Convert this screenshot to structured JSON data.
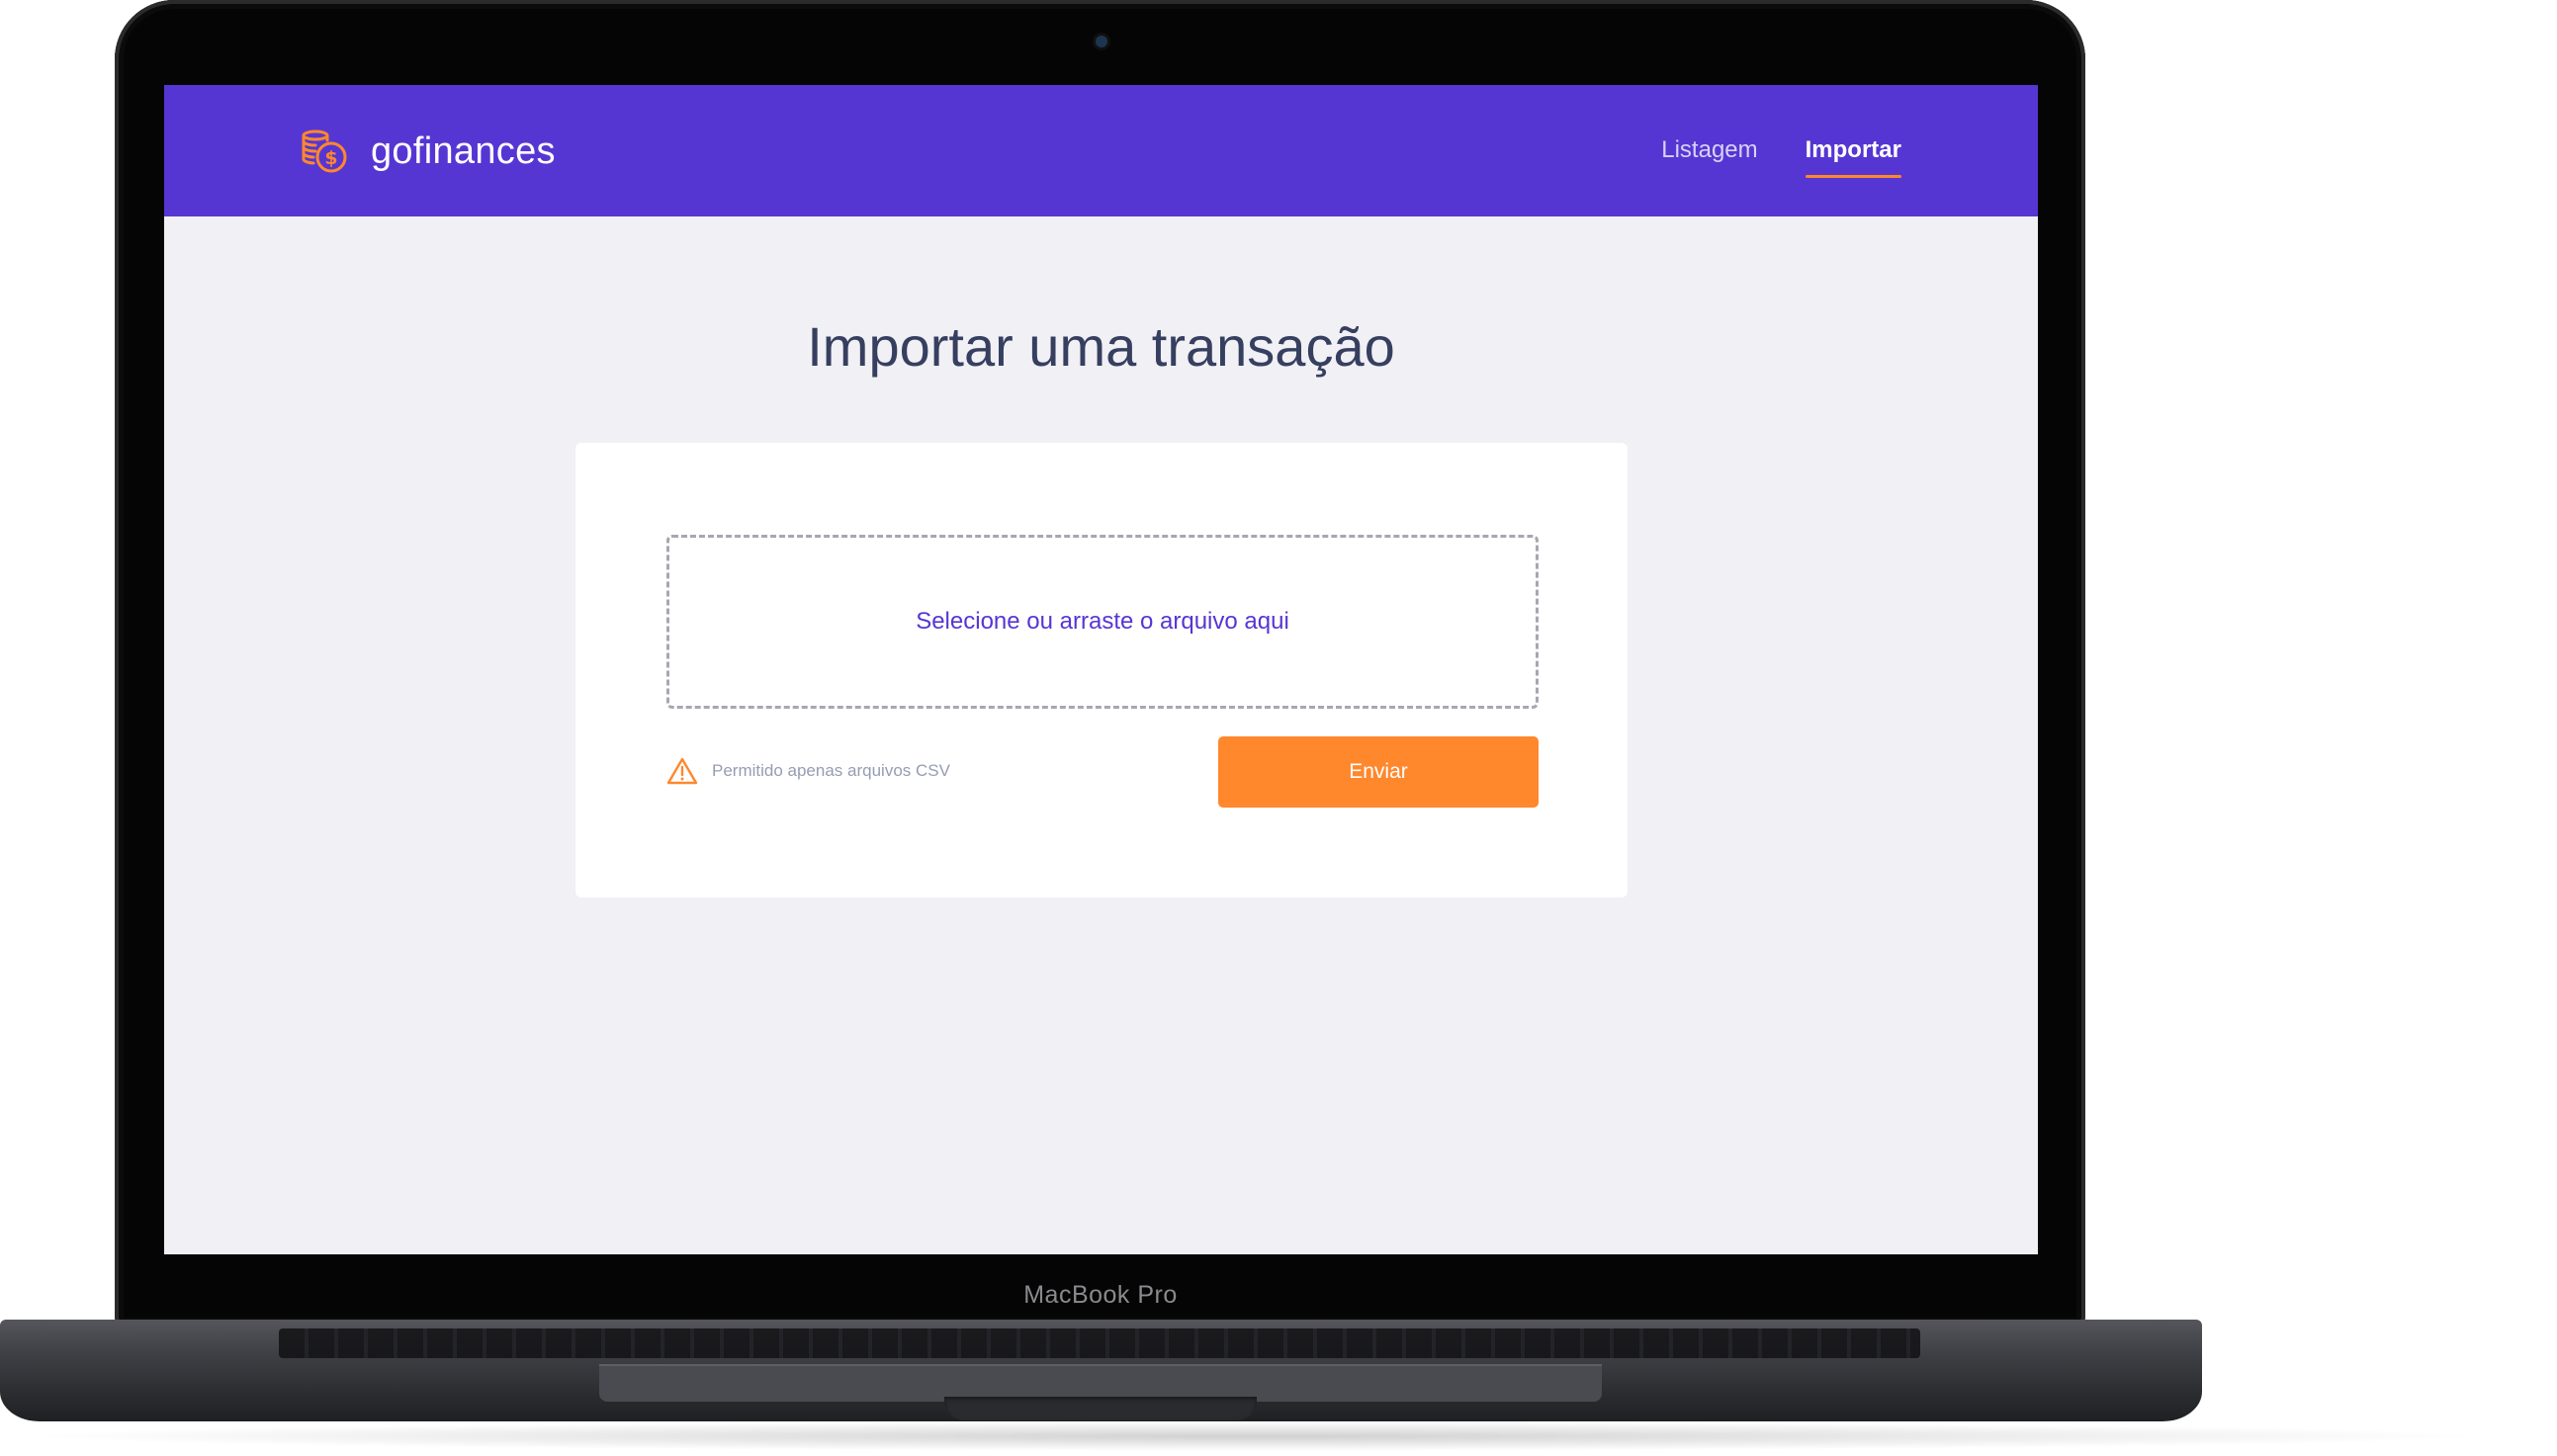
{
  "device": {
    "model_label": "MacBook Pro"
  },
  "app": {
    "name": "gofinances",
    "logo_icon": "coins-dollar-icon"
  },
  "nav": {
    "items": [
      {
        "label": "Listagem",
        "active": false
      },
      {
        "label": "Importar",
        "active": true
      }
    ]
  },
  "main": {
    "title": "Importar uma transação",
    "dropzone_text": "Selecione ou arraste o arquivo aqui",
    "hint": {
      "icon": "warning-icon",
      "text": "Permitido apenas arquivos CSV"
    },
    "submit_label": "Enviar"
  },
  "colors": {
    "header_bg": "#5636d3",
    "accent": "#ff872c",
    "page_bg": "#f0f0f5",
    "title_text": "#363f5f",
    "dropzone_text": "#5636d3",
    "hint_text": "#969cb3"
  }
}
